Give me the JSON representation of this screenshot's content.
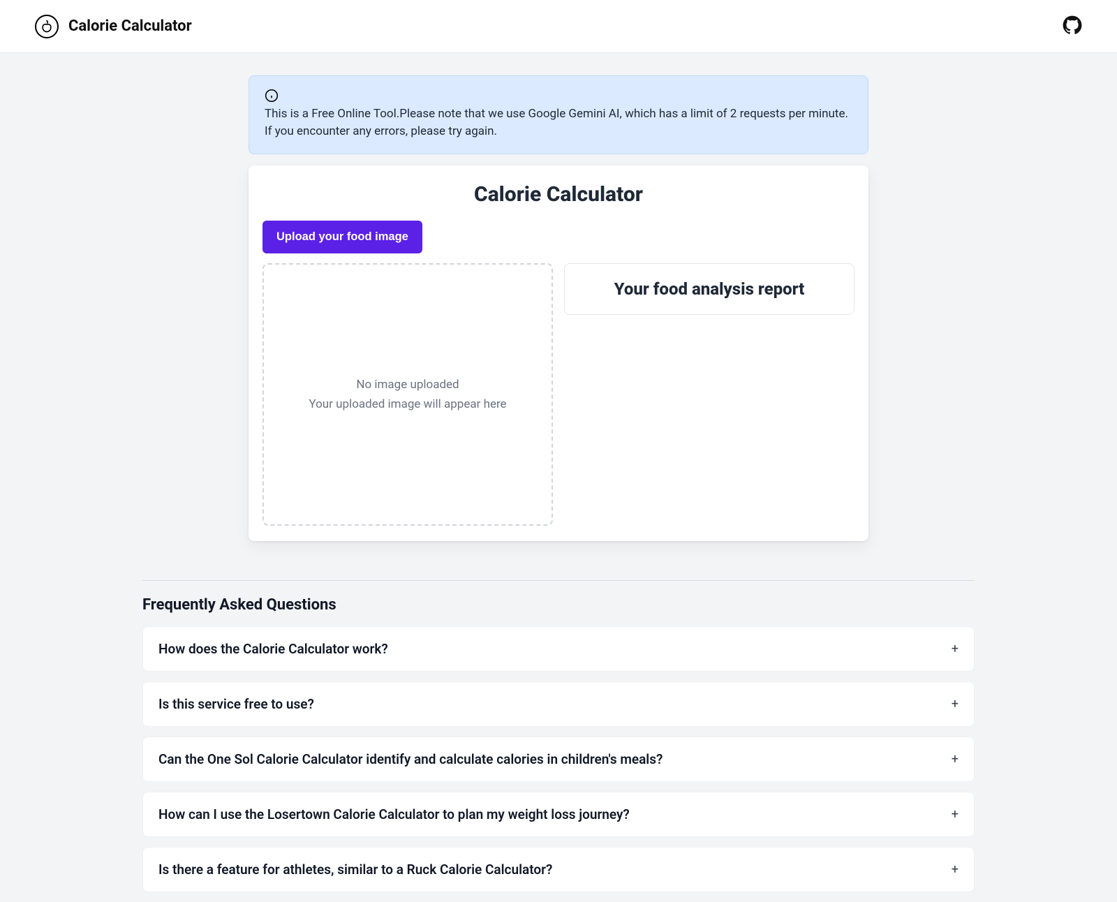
{
  "header": {
    "brand": "Calorie Calculator"
  },
  "alert": {
    "text": "This is a Free Online Tool.Please note that we use Google Gemini AI, which has a limit of 2 requests per minute. If you encounter any errors, please try again."
  },
  "card": {
    "title": "Calorie Calculator",
    "upload_label": "Upload your food image",
    "dropzone": {
      "title": "No image uploaded",
      "subtitle": "Your uploaded image will appear here"
    },
    "report_title": "Your food analysis report"
  },
  "faq": {
    "heading": "Frequently Asked Questions",
    "items": [
      {
        "q": "How does the Calorie Calculator work?"
      },
      {
        "q": "Is this service free to use?"
      },
      {
        "q": "Can the One Sol Calorie Calculator identify and calculate calories in children's meals?"
      },
      {
        "q": "How can I use the Losertown Calorie Calculator to plan my weight loss journey?"
      },
      {
        "q": "Is there a feature for athletes, similar to a Ruck Calorie Calculator?"
      }
    ],
    "plus": "+"
  }
}
